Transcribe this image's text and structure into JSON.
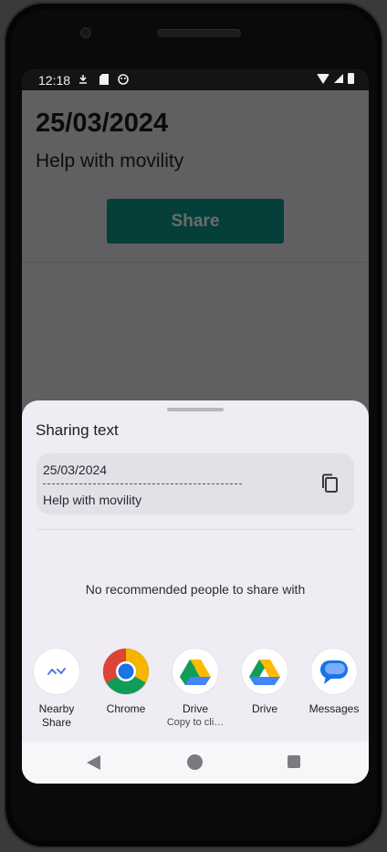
{
  "status_bar": {
    "time": "12:18",
    "left_icons": [
      "download-icon",
      "sd-card-icon",
      "assistant-icon"
    ],
    "right_icons": [
      "wifi-icon",
      "signal-icon",
      "battery-icon"
    ]
  },
  "app": {
    "date": "25/03/2024",
    "subtitle": "Help with movility",
    "share_button": "Share"
  },
  "share_sheet": {
    "title": "Sharing text",
    "preview": {
      "date": "25/03/2024",
      "separator": "---------------------------------------------------------------------",
      "text": "Help with movility"
    },
    "no_recommendations": "No recommended people to share with",
    "targets": [
      {
        "label": "Nearby\nShare",
        "sub": "",
        "icon": "nearby-share-icon"
      },
      {
        "label": "Chrome",
        "sub": "",
        "icon": "chrome-icon"
      },
      {
        "label": "Drive",
        "sub": "Copy to cli…",
        "icon": "drive-icon"
      },
      {
        "label": "Drive",
        "sub": "",
        "icon": "drive-icon"
      },
      {
        "label": "Messages",
        "sub": "",
        "icon": "messages-icon"
      }
    ]
  },
  "nav_bar": {
    "buttons": [
      "back",
      "home",
      "recents"
    ]
  },
  "colors": {
    "share_button_bg": "#063f3a",
    "sheet_bg": "#efedf3",
    "scrim": "#606062"
  }
}
